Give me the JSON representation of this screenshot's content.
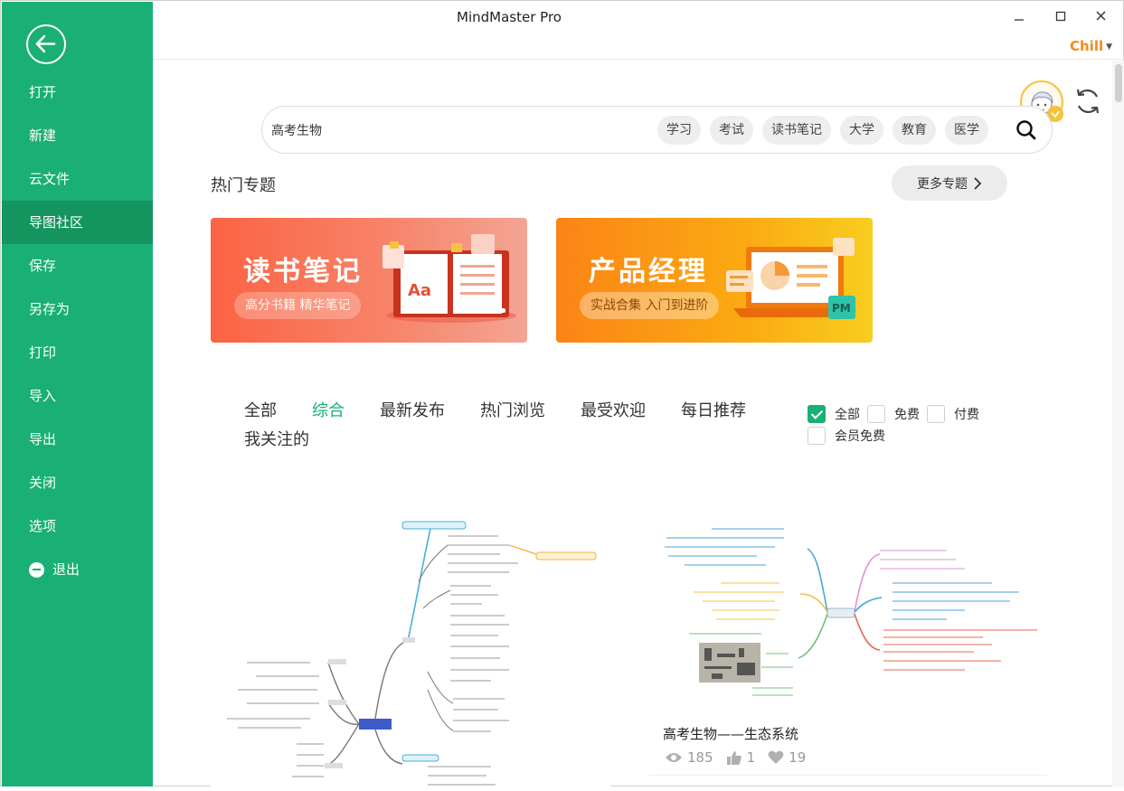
{
  "window": {
    "title": "MindMaster Pro",
    "user": "Chill"
  },
  "sidebar": {
    "items": [
      {
        "label": "打开"
      },
      {
        "label": "新建"
      },
      {
        "label": "云文件"
      },
      {
        "label": "导图社区",
        "active": true
      },
      {
        "label": "保存"
      },
      {
        "label": "另存为"
      },
      {
        "label": "打印"
      },
      {
        "label": "导入"
      },
      {
        "label": "导出"
      },
      {
        "label": "关闭"
      },
      {
        "label": "选项"
      }
    ],
    "exit_label": "退出"
  },
  "search": {
    "value": "高考生物",
    "tags": [
      "学习",
      "考试",
      "读书笔记",
      "大学",
      "教育",
      "医学"
    ]
  },
  "hot_topics": {
    "title": "热门专题",
    "more_label": "更多专题",
    "banners": [
      {
        "title": "读书笔记",
        "subtitle": "高分书籍 精华笔记"
      },
      {
        "title": "产品经理",
        "subtitle": "实战合集 入门到进阶"
      }
    ]
  },
  "filters": {
    "tabs": [
      "全部",
      "综合",
      "最新发布",
      "热门浏览",
      "最受欢迎",
      "每日推荐",
      "我关注的"
    ],
    "active_tab": "综合",
    "checkboxes": [
      {
        "label": "全部",
        "checked": true
      },
      {
        "label": "免费",
        "checked": false
      },
      {
        "label": "付费",
        "checked": false
      },
      {
        "label": "会员免费",
        "checked": false
      }
    ]
  },
  "cards": [
    {
      "title": "",
      "views": "",
      "likes": "",
      "favorites": ""
    },
    {
      "title": "高考生物——生态系统",
      "views": "185",
      "likes": "1",
      "favorites": "19"
    }
  ],
  "colors": {
    "sidebar": "#1aaf74",
    "sidebar_active": "#14955f",
    "accent": "#1aaf74",
    "user": "#f08c1e"
  }
}
